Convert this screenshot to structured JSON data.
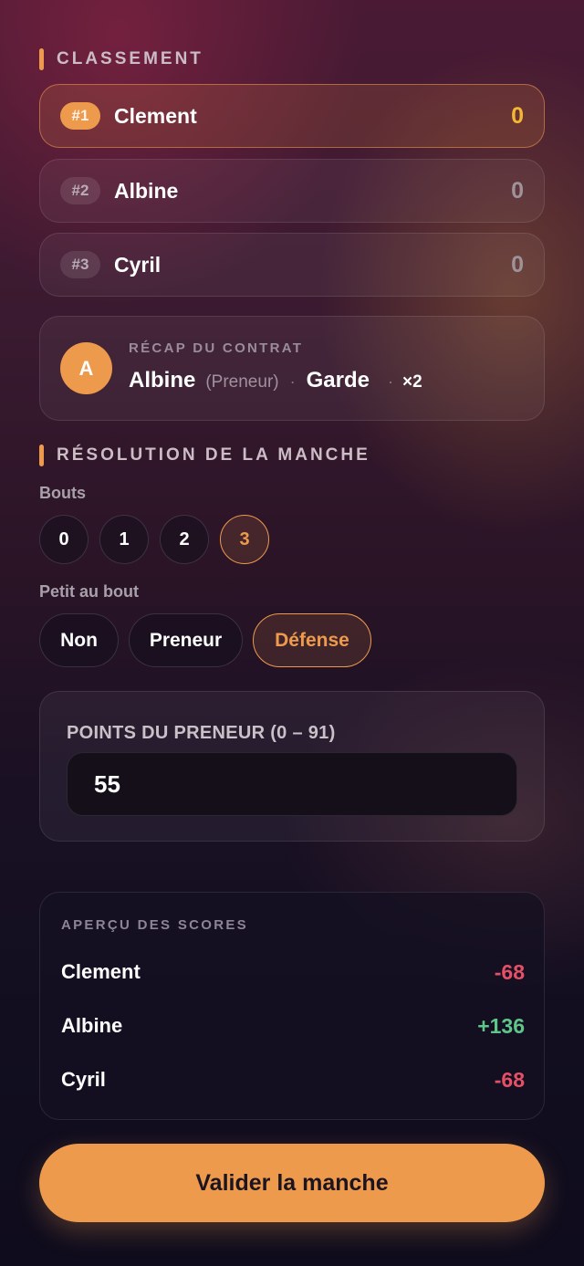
{
  "ranking": {
    "title": "CLASSEMENT",
    "rows": [
      {
        "rank": "#1",
        "name": "Clement",
        "score": "0"
      },
      {
        "rank": "#2",
        "name": "Albine",
        "score": "0"
      },
      {
        "rank": "#3",
        "name": "Cyril",
        "score": "0"
      }
    ]
  },
  "recap": {
    "avatar_letter": "A",
    "label": "RÉCAP DU CONTRAT",
    "player": "Albine",
    "role": "(Preneur)",
    "separator": "·",
    "contract": "Garde",
    "multiplier": "×2"
  },
  "resolution": {
    "title": "RÉSOLUTION DE LA MANCHE",
    "bouts": {
      "label": "Bouts",
      "options": [
        "0",
        "1",
        "2",
        "3"
      ],
      "selected": "3"
    },
    "petit_au_bout": {
      "label": "Petit au bout",
      "options": [
        "Non",
        "Preneur",
        "Défense"
      ],
      "selected": "Défense"
    },
    "points": {
      "label": "POINTS DU PRENEUR (0 – 91)",
      "value": "55"
    }
  },
  "preview": {
    "label": "APERÇU DES SCORES",
    "rows": [
      {
        "name": "Clement",
        "delta": "-68"
      },
      {
        "name": "Albine",
        "delta": "+136"
      },
      {
        "name": "Cyril",
        "delta": "-68"
      }
    ]
  },
  "validate_label": "Valider la manche",
  "colors": {
    "accent": "#ee9a4c",
    "first_score": "#f4b733",
    "negative": "#e65066",
    "positive": "#5fc68a"
  }
}
